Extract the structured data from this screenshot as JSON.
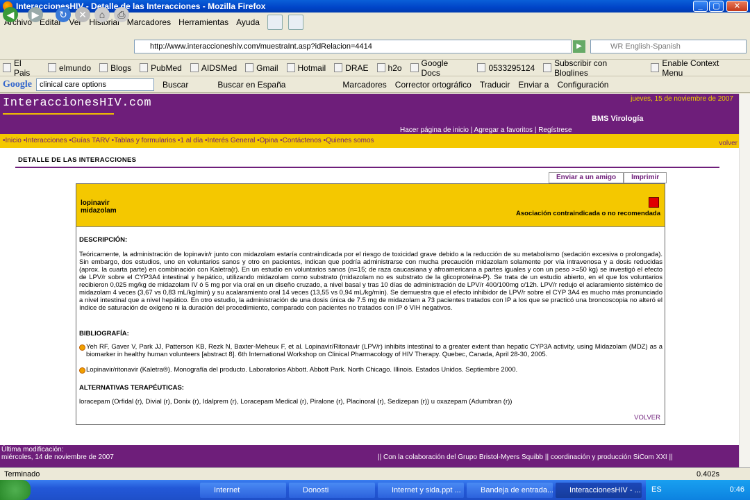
{
  "window": {
    "title": "InteraccionesHIV - Detalle de las Interacciones - Mozilla Firefox"
  },
  "menu": [
    "Archivo",
    "Editar",
    "Ver",
    "Historial",
    "Marcadores",
    "Herramientas",
    "Ayuda"
  ],
  "address": {
    "url": "http://www.interaccioneshiv.com/muestraInt.asp?idRelacion=4414"
  },
  "searchbar": {
    "placeholder": "WR English-Spanish"
  },
  "bookmarks": [
    "El Pais",
    "elmundo",
    "Blogs",
    "PubMed",
    "AIDSMed",
    "Gmail",
    "Hotmail",
    "DRAE",
    "h2o",
    "Google Docs",
    "0533295124",
    "Subscribir con Bloglines",
    "Enable Context Menu"
  ],
  "google_toolbar": {
    "logo": "Google",
    "query": "clinical care options",
    "items": [
      "Buscar",
      "Buscar en España",
      "Marcadores",
      "Corrector ortográfico",
      "Traducir",
      "Enviar a",
      "Configuración"
    ]
  },
  "site": {
    "logo": "InteraccionesHIV.com",
    "date": "jueves, 15 de noviembre de 2007",
    "sponsor": "BMS Virología",
    "header_links": "Hacer página de inicio | Agregar a favoritos | Regístrese",
    "nav": "•Inicio  •Interacciones •Guías TARV  •Tablas y formularios •1 al día  •Interés General  •Opina  •Contáctenos  •Quienes somos",
    "volver_top": "volver",
    "page_title": "DETALLE DE LAS INTERACCIONES",
    "btn_friend": "Enviar a un amigo",
    "btn_print": "Imprimir"
  },
  "interaction": {
    "drug1": "lopinavir",
    "drug2": "midazolam",
    "classification": "Asociación contraindicada o no recomendada",
    "classification_color": "#e00000",
    "desc_heading": "DESCRIPCIÓN:",
    "description": "Teóricamente, la administración de lopinavir/r junto con midazolam estaría contraindicada por el riesgo de toxicidad grave debido a la reducción de su metabolismo (sedación excesiva o prolongada). Sin embargo, dos estudios, uno en voluntarios sanos y otro en pacientes, indican que podría administrarse con mucha precaución midazolam solamente por vía intravenosa y a dosis reducidas (aprox. la cuarta parte) en combinación con Kaletra(r). En un estudio en voluntarios sanos (n=15; de raza caucasiana y afroamericana a partes iguales y con un peso >=50 kg) se investigó el efecto de LPV/r sobre el CYP3A4 intestinal y hepático, utilizando midazolam como substrato (midazolam no es substrato de la glicoproteína-P). Se trata de un estudio abierto, en el que los voluntarios recibieron 0,025 mg/kg de midazolam IV ó 5 mg por vía oral en un diseño cruzado, a nivel basal y tras 10 días de administración de LPV/r 400/100mg c/12h. LPV/r redujo el aclaramiento sistémico de midazolam 4 veces (3,67 vs 0,83 mL/kg/min) y su acalaramiento oral 14 veces (13,55 vs 0,94 mL/kg/min). Se demuestra que el efecto inhibidor de LPV/r sobre el CYP 3A4 es mucho más pronunciado a nivel intestinal que a nivel hepático. En otro estudio, la administración de una dosis única de 7.5 mg de midazolam a 73 pacientes tratados con IP a los que se practicó una broncoscopia no alteró el índice de saturación de oxígeno ni la duración del procedimiento, comparado con pacientes no tratados con IP ó VIH negativos.",
    "bib_heading": "BIBLIOGRAFÍA:",
    "bib": [
      "Yeh RF, Gaver V, Park JJ, Patterson KB, Rezk N, Baxter-Meheux F, et al. Lopinavir/Ritonavir (LPV/r) inhibits intestinal to a greater extent than hepatic CYP3A activity, using Midazolam (MDZ) as a biomarker in healthy human volunteers [abstract 8]. 6th International Workshop on Clinical Pharmacology of HIV Therapy. Quebec, Canada, April 28-30, 2005.",
      "Lopinavir/ritonavir (Kaletra®). Monografía del producto. Laboratorios Abbott. Abbott Park. North Chicago. Illinois. Estados Unidos. Septiembre 2000."
    ],
    "alt_heading": "ALTERNATIVAS TERAPÉUTICAS:",
    "alternatives": "loracepam (Orfidal (r), Divial (r), Donix (r), Idalprem (r), Loracepam Medical (r), Piralone (r), Placinoral (r), Sedizepan (r)) u oxazepam (Adumbran (r))",
    "volver": "VOLVER"
  },
  "footer": {
    "lastmod_label": "Última modificación:",
    "lastmod_date": "miércoles, 14 de noviembre de 2007",
    "credits": "|| Con la colaboración del Grupo Bristol-Myers Squibb  ||  coordinación y producción SiCom XXI  ||"
  },
  "status": {
    "text": "Terminado",
    "latency": "0.402s"
  },
  "taskbar": {
    "tasks": [
      "Internet",
      "Donosti",
      "Internet y sida.ppt ...",
      "Bandeja de entrada...",
      "InteraccionesHIV - ..."
    ],
    "lang": "ES",
    "clock": "0:46"
  }
}
